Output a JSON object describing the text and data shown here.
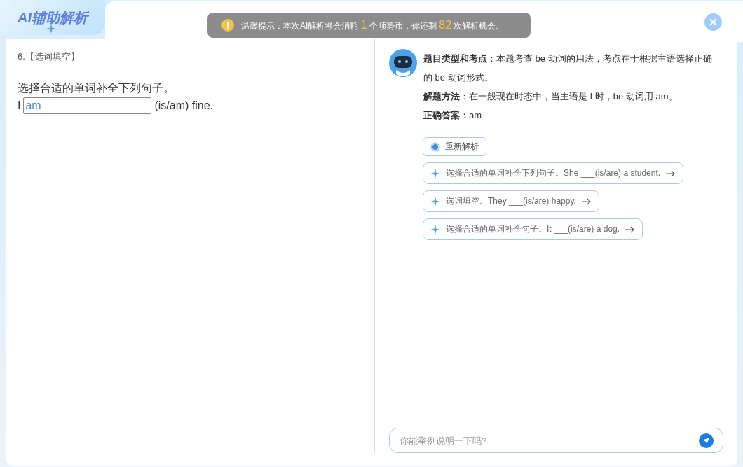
{
  "header": {
    "title": "AI辅助解析"
  },
  "notice": {
    "segments": [
      {
        "text": "温馨提示：本次AI解析将会消耗 ",
        "highlight": false
      },
      {
        "text": "1",
        "highlight": true
      },
      {
        "text": " 个顺势币，你还剩 ",
        "highlight": false
      },
      {
        "text": "82",
        "highlight": true
      },
      {
        "text": " 次解析机会。",
        "highlight": false
      }
    ]
  },
  "question": {
    "heading": "6.【选词填空】",
    "instruction": "选择合适的单词补全下列句子。",
    "prefix": "I",
    "answer": "am",
    "suffix": "(is/am) fine."
  },
  "analysis": [
    "**题目类型和考点**：本题考查 be 动词的用法，考点在于根据主语选择正确的 be 动词形式。",
    "**解题方法**：在一般现在时态中，当主语是 I 时，be 动词用 am。",
    "**正确答案**：am"
  ],
  "reanalyze": "重新解析",
  "suggestions": [
    "选择合适的单词补全下列句子。She ___(is/are) a student.",
    "选词填空。They ___(is/are) happy.",
    "选择合适的单词补全句子。It ___(is/are) a dog."
  ],
  "chat": {
    "placeholder": "你能举例说明一下吗?"
  }
}
